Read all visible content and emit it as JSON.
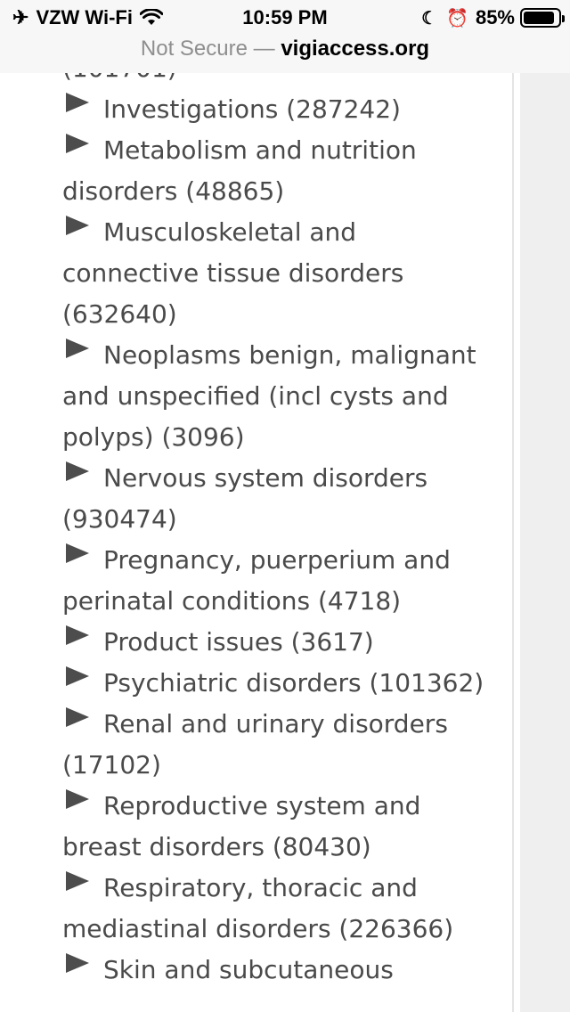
{
  "status_bar": {
    "carrier": "VZW Wi-Fi",
    "time": "10:59 PM",
    "battery": "85%",
    "icons": [
      "airplane-icon",
      "wifi-icon",
      "moon-icon",
      "alarm-icon",
      "battery-icon"
    ]
  },
  "url_bar": {
    "security": "Not Secure",
    "separator": "—",
    "domain": "vigiaccess.org"
  },
  "reactions": [
    {
      "label": "Investigations (287242)"
    },
    {
      "label": "Metabolism and nutrition disorders (48865)"
    },
    {
      "label": "Musculoskeletal and connective tissue disorders (632640)"
    },
    {
      "label": "Neoplasms benign, malignant and unspecified (incl cysts and polyps) (3096)"
    },
    {
      "label": "Nervous system disorders (930474)"
    },
    {
      "label": "Pregnancy, puerperium and perinatal conditions (4718)"
    },
    {
      "label": "Product issues (3617)"
    },
    {
      "label": "Psychiatric disorders (101362)"
    },
    {
      "label": "Renal and urinary disorders (17102)"
    },
    {
      "label": "Reproductive system and breast disorders (80430)"
    },
    {
      "label": "Respiratory, thoracic and mediastinal disorders (226366)"
    },
    {
      "label": "Skin and subcutaneous"
    }
  ],
  "colors": {
    "text": "#4a4a4a",
    "triangle": "#4d4d4d",
    "chrome_bg": "#f7f7f7",
    "insecure_text": "#8e8e8e"
  }
}
